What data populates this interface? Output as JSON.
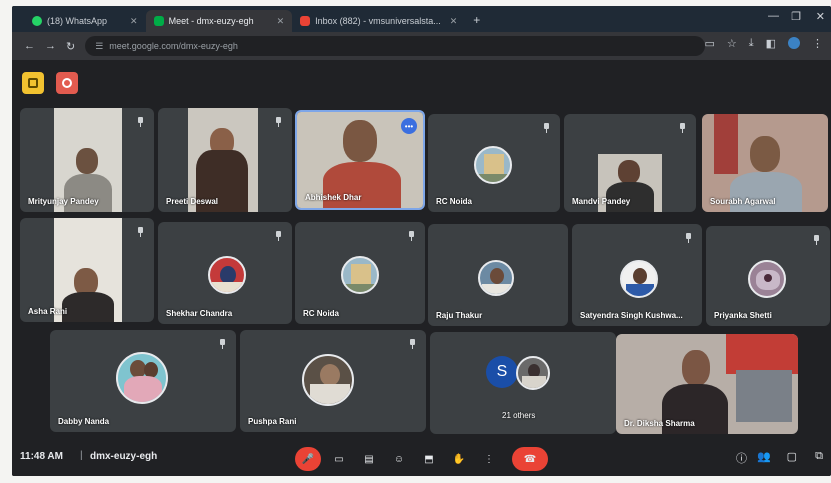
{
  "browser": {
    "tabs": [
      {
        "label": "(18) WhatsApp",
        "active": false
      },
      {
        "label": "Meet - dmx-euzy-egh",
        "active": true
      },
      {
        "label": "Inbox (882) - vmsuniversalsta...",
        "active": false
      }
    ],
    "url": "meet.google.com/dmx-euzy-egh"
  },
  "participants": [
    {
      "name": "Mrityunjay Pandey"
    },
    {
      "name": "Preeti Deswal"
    },
    {
      "name": "Abhishek Dhar"
    },
    {
      "name": "RC Noida"
    },
    {
      "name": "Mandvi Pandey"
    },
    {
      "name": "Sourabh Agarwal"
    },
    {
      "name": "Asha Rani"
    },
    {
      "name": "Shekhar Chandra"
    },
    {
      "name": "RC Noida"
    },
    {
      "name": "Raju Thakur"
    },
    {
      "name": "Satyendra Singh Kushwa..."
    },
    {
      "name": "Priyanka Shetti"
    },
    {
      "name": "Dabby Nanda"
    },
    {
      "name": "Pushpa Rani"
    },
    {
      "name": "21 others"
    },
    {
      "name": "Dr. Diksha Sharma"
    }
  ],
  "others_avatar_letter": "S",
  "bottom": {
    "time": "11:48 AM",
    "separator": "|",
    "meeting_code": "dmx-euzy-egh"
  },
  "colors": {
    "background": "#202124",
    "tile": "#3c4043",
    "accent_red": "#ea4335",
    "speaking_blue": "#3b6fe0"
  }
}
